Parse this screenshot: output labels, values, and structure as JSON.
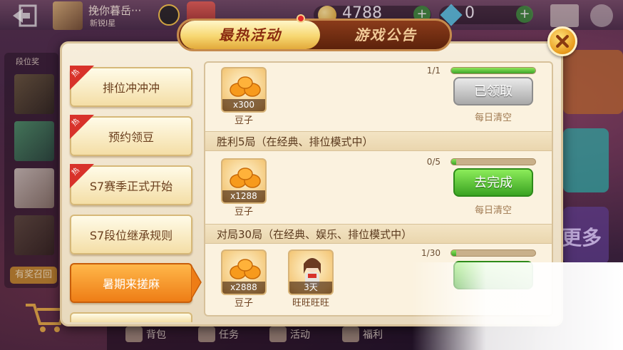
{
  "topbar": {
    "nickname": "挽你暮岳···",
    "rank": "新锐I星",
    "coins": "4788",
    "diamonds": "0"
  },
  "lobby": {
    "side_label": "段位奖",
    "reward_badge": "有奖召回",
    "more_label": "更多",
    "nav": [
      "背包",
      "任务",
      "活动",
      "福利"
    ]
  },
  "tabs": {
    "active": "最热活动",
    "inactive": "游戏公告"
  },
  "menu": [
    {
      "label": "排位冲冲冲",
      "hot": true,
      "active": false
    },
    {
      "label": "预约领豆",
      "hot": true,
      "active": false
    },
    {
      "label": "S7赛季正式开始",
      "hot": true,
      "active": false
    },
    {
      "label": "S7段位继承规则",
      "hot": false,
      "active": false
    },
    {
      "label": "暑期来搓麻",
      "hot": false,
      "active": true
    }
  ],
  "hot_tag_text": "热",
  "tasks": [
    {
      "title": "",
      "progress_text": "1/1",
      "progress": 1.0,
      "rewards": [
        {
          "qty": "x300",
          "name": "豆子",
          "icon": "beans-icon"
        }
      ],
      "button": "已领取",
      "button_state": "claimed",
      "note": "每日清空"
    },
    {
      "title": "胜利5局（在经典、排位模式中）",
      "progress_text": "0/5",
      "progress": 0.0,
      "rewards": [
        {
          "qty": "x1288",
          "name": "豆子",
          "icon": "beans-icon"
        }
      ],
      "button": "去完成",
      "button_state": "go",
      "note": "每日清空"
    },
    {
      "title": "对局30局（在经典、娱乐、排位模式中）",
      "progress_text": "1/30",
      "progress": 0.033,
      "rewards": [
        {
          "qty": "x2888",
          "name": "豆子",
          "icon": "beans-icon"
        },
        {
          "qty": "3天",
          "name": "旺旺旺旺",
          "icon": "character-icon"
        }
      ],
      "button": "",
      "button_state": "go",
      "note": ""
    }
  ],
  "colors": {
    "accent_orange": "#ee7d16",
    "progress_green": "#3da42a",
    "tab_gold": "#f7d771",
    "hot_red": "#d8322a"
  }
}
